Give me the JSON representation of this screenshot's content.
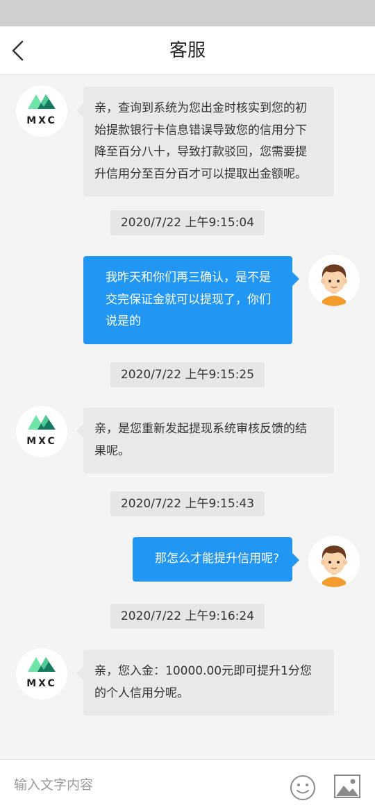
{
  "header": {
    "title": "客服",
    "back_icon": "chevron-left-icon"
  },
  "agent": {
    "brand": "MXC",
    "brand_colors": {
      "light_green": "#6ee5a7",
      "dark_green": "#157a5f",
      "text": "#222222"
    }
  },
  "user": {
    "avatar_icon": "boy-avatar-icon"
  },
  "messages": [
    {
      "from": "agent",
      "lines": [
        "亲，查询到系统为您出金时核实到您的初",
        "始提款银行卡信息错误导致您的信用分下",
        "降至百分八十，导致打款驳回，您需要提",
        "升信用分至百分百才可以提取出金额呢。"
      ]
    },
    {
      "timestamp": "2020/7/22 上午9:15:04"
    },
    {
      "from": "user",
      "lines": [
        "我昨天和你们再三确认，是不是",
        "交完保证金就可以提现了，你们",
        "说是的"
      ]
    },
    {
      "timestamp": "2020/7/22 上午9:15:25"
    },
    {
      "from": "agent",
      "lines": [
        "亲，是您重新发起提现系统审核反馈的结",
        "果呢。"
      ]
    },
    {
      "timestamp": "2020/7/22 上午9:15:43"
    },
    {
      "from": "user",
      "lines": [
        "那怎么才能提升信用呢?"
      ]
    },
    {
      "timestamp": "2020/7/22 上午9:16:24"
    },
    {
      "from": "agent",
      "lines": [
        "亲，您入金：10000.00元即可提升1分您",
        "的个人信用分呢。"
      ]
    }
  ],
  "input": {
    "placeholder": "输入文字内容",
    "value": "",
    "emoji_icon": "emoji-smile-icon",
    "image_icon": "image-icon"
  },
  "colors": {
    "user_bubble": "#2196f3",
    "agent_bubble": "#e9e9e9",
    "background": "#f4f4f4"
  }
}
